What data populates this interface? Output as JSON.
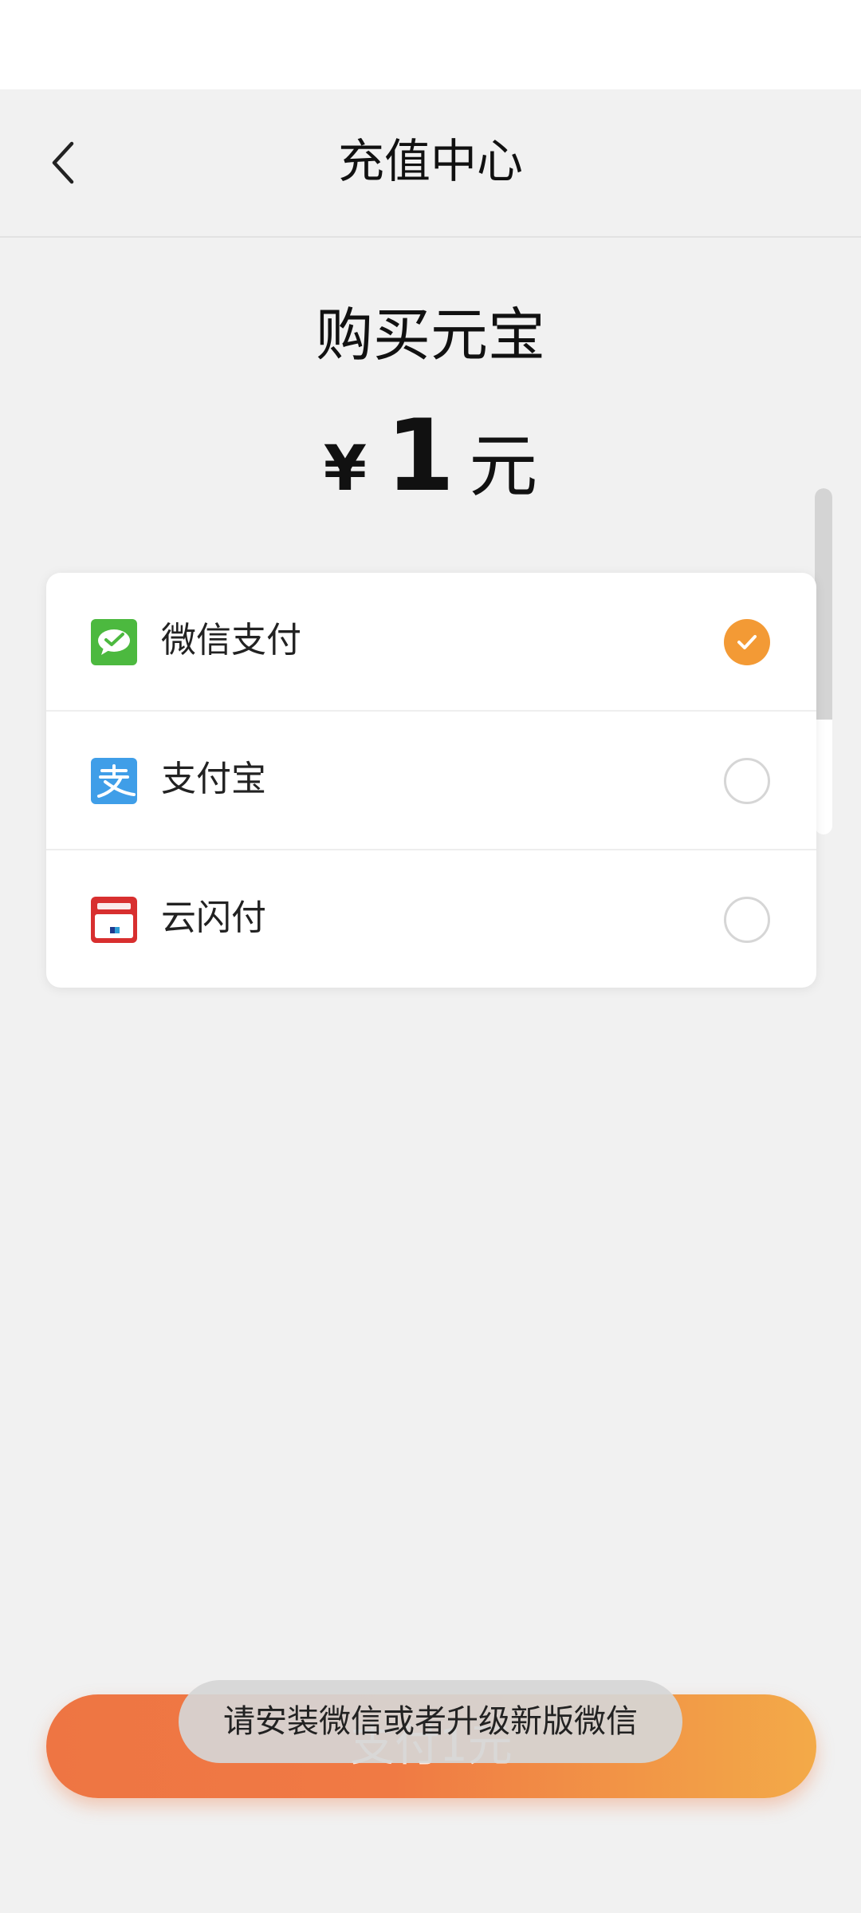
{
  "header": {
    "title": "充值中心"
  },
  "purchase": {
    "title": "购买元宝",
    "currency": "¥",
    "amount": "1",
    "unit": "元"
  },
  "payment_methods": [
    {
      "label": "微信支付",
      "icon": "wechat-pay-icon",
      "selected": true
    },
    {
      "label": "支付宝",
      "icon": "alipay-icon",
      "selected": false
    },
    {
      "label": "云闪付",
      "icon": "unionpay-icon",
      "selected": false
    }
  ],
  "pay_button": {
    "label": "支付1元"
  },
  "toast": {
    "message": "请安装微信或者升级新版微信"
  },
  "colors": {
    "accent": "#f39a35",
    "button_start": "#ee7543",
    "button_end": "#f3aa48",
    "wechat_green": "#4cb93f",
    "alipay_blue": "#3f9ee8",
    "unionpay_red": "#d82f2f"
  }
}
